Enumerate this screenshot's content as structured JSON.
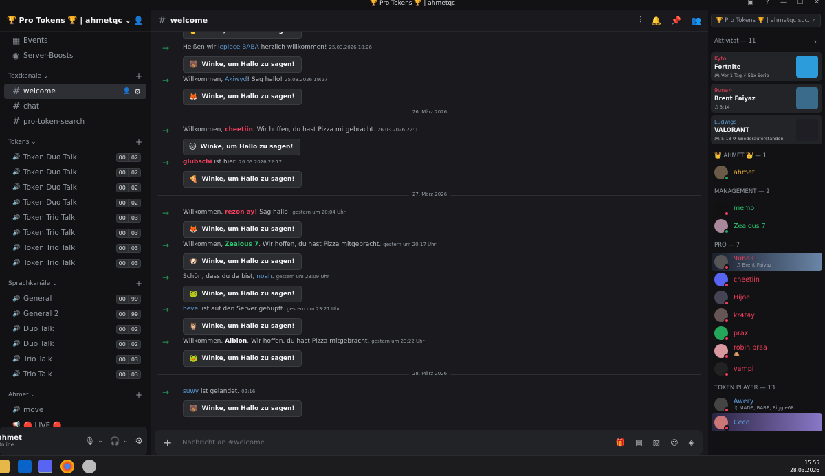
{
  "window": {
    "title": "🏆 Pro Tokens 🏆 | ahmetqc"
  },
  "server": {
    "name": "🏆 Pro Tokens 🏆 | ahmetqc"
  },
  "sidebar": {
    "top_items": [
      {
        "label": "Events",
        "icon": "calendar-icon"
      },
      {
        "label": "Server-Boosts",
        "icon": "boost-icon"
      }
    ],
    "categories": [
      {
        "label": "Textkanäle",
        "channels": [
          {
            "label": "welcome",
            "type": "text",
            "active": true
          },
          {
            "label": "chat",
            "type": "text"
          },
          {
            "label": "pro-token-search",
            "type": "text"
          }
        ]
      },
      {
        "label": "Tokens",
        "channels": [
          {
            "label": "Token Duo Talk",
            "type": "voice",
            "count": "00",
            "limit": "02"
          },
          {
            "label": "Token Duo Talk",
            "type": "voice",
            "count": "00",
            "limit": "02"
          },
          {
            "label": "Token Duo Talk",
            "type": "voice",
            "count": "00",
            "limit": "02"
          },
          {
            "label": "Token Duo Talk",
            "type": "voice",
            "count": "00",
            "limit": "02"
          },
          {
            "label": "Token Trio Talk",
            "type": "voice",
            "count": "00",
            "limit": "03"
          },
          {
            "label": "Token Trio Talk",
            "type": "voice",
            "count": "00",
            "limit": "03"
          },
          {
            "label": "Token Trio Talk",
            "type": "voice",
            "count": "00",
            "limit": "03"
          },
          {
            "label": "Token Trio Talk",
            "type": "voice",
            "count": "00",
            "limit": "03"
          }
        ]
      },
      {
        "label": "Sprachkanäle",
        "channels": [
          {
            "label": "General",
            "type": "voice",
            "count": "00",
            "limit": "99"
          },
          {
            "label": "General 2",
            "type": "voice",
            "count": "00",
            "limit": "99"
          },
          {
            "label": "Duo Talk",
            "type": "voice",
            "count": "00",
            "limit": "02"
          },
          {
            "label": "Duo Talk",
            "type": "voice",
            "count": "00",
            "limit": "02"
          },
          {
            "label": "Trio Talk",
            "type": "voice",
            "count": "00",
            "limit": "03"
          },
          {
            "label": "Trio Talk",
            "type": "voice",
            "count": "00",
            "limit": "03"
          }
        ]
      },
      {
        "label": "Ahmet",
        "channels": [
          {
            "label": "move",
            "type": "voice"
          },
          {
            "label": "🔴 LIVE 🔴",
            "type": "stage"
          }
        ]
      }
    ]
  },
  "user_panel": {
    "name": "ahmet",
    "status": "Online"
  },
  "channel": {
    "name": "welcome",
    "composer_placeholder": "Nachricht an #welcome"
  },
  "search": {
    "placeholder": "🏆 Pro Tokens 🏆 | ahmetqc suc..."
  },
  "wave_label": "Winke, um Hallo zu sagen!",
  "messages": [
    {
      "pre": "Heißen wir ",
      "user": "lepiece BABA",
      "post": " herzlich willkommen!",
      "ts": "25.03.2026 18:26",
      "color": "#5b9bd5"
    },
    {
      "pre": "Willkommen, ",
      "user": "Akiwyd",
      "post": "! Sag hallo!",
      "ts": "25.03.2026 19:27",
      "color": "#5b9bd5"
    },
    {
      "divider": "26. März 2026"
    },
    {
      "pre": "Willkommen, ",
      "user": "cheetiin",
      "post": ". Wir hoffen, du hast Pizza mitgebracht.",
      "ts": "26.03.2026 22:01",
      "color": "#f23f5d"
    },
    {
      "pre": "",
      "user": "glubschi",
      "post": " ist hier.",
      "ts": "26.03.2026 22:17",
      "color": "#f23f5d"
    },
    {
      "divider": "27. März 2026"
    },
    {
      "pre": "Willkommen, ",
      "user": "rezon ay!",
      "post": " Sag hallo!",
      "ts": "gestern um 20:04 Uhr",
      "color": "#f23f5d"
    },
    {
      "pre": "Willkommen, ",
      "user": "Zealous 7",
      "post": ". Wir hoffen, du hast Pizza mitgebracht.",
      "ts": "gestern um 20:17 Uhr",
      "color": "#2dc770"
    },
    {
      "pre": "Schön, dass du da bist, ",
      "user": "noah",
      "post": ".",
      "ts": "gestern um 23:09 Uhr",
      "color": "#5b9bd5"
    },
    {
      "pre": "",
      "user": "bevel",
      "post": " ist auf den Server gehüpft.",
      "ts": "gestern um 23:21 Uhr",
      "color": "#5b9bd5"
    },
    {
      "pre": "Willkommen, ",
      "user": "Albion",
      "post": ". Wir hoffen, du hast Pizza mitgebracht.",
      "ts": "gestern um 23:22 Uhr",
      "color": "#f2f3f5"
    },
    {
      "divider": "28. März 2026"
    },
    {
      "pre": "",
      "user": "suwy",
      "post": " ist gelandet.",
      "ts": "02:16",
      "color": "#5b9bd5"
    }
  ],
  "activity": {
    "header": "Aktivität — 11",
    "cards": [
      {
        "user": "Kyto",
        "title": "Fortnite",
        "detail": "🎮 Vor 1 Tag  ⚡ 51x Serie",
        "user_color": "#f23f5d",
        "thumb_color": "#2d9cdb"
      },
      {
        "user": "9una✧",
        "title": "Brent Faiyaz",
        "detail": "♫ 3:14",
        "user_color": "#f23f5d",
        "thumb_color": "#3a6b8a"
      },
      {
        "user": "Ludwigs",
        "title": "VALORANT",
        "detail": "🎮 5:18  ⟳ Wiederauferstanden",
        "user_color": "#5b9bd5",
        "thumb_color": "#1e1e24"
      }
    ]
  },
  "member_groups": [
    {
      "label": "👑 AHMET 👑 — 1",
      "members": [
        {
          "name": "ahmet",
          "color": "#f0b232",
          "status": "#23a55a",
          "av": "#6b5a48"
        }
      ]
    },
    {
      "label": "MANAGEMENT — 2",
      "members": [
        {
          "name": "memo",
          "color": "#2dc770",
          "status": "#f23f5d",
          "av": "#111"
        },
        {
          "name": "Zealous 7",
          "color": "#2dc770",
          "status": "#23a55a",
          "av": "#a8889a"
        }
      ]
    },
    {
      "label": "PRO — 7",
      "members": [
        {
          "name": "9una✧",
          "color": "#f23f5d",
          "status": "#f23f5d",
          "av": "#555",
          "sub": "♫ Brent Faiyaz"
        },
        {
          "name": "cheetiin",
          "color": "#f23f5d",
          "status": "#f23f5d",
          "av": "#5865f2"
        },
        {
          "name": "Hijoe",
          "color": "#f23f5d",
          "status": "#f23f5d",
          "av": "#445"
        },
        {
          "name": "kr4t4y",
          "color": "#f23f5d",
          "status": "#f23f5d",
          "av": "#655"
        },
        {
          "name": "prax",
          "color": "#f23f5d",
          "status": "#f23f5d",
          "av": "#23a55a"
        },
        {
          "name": "robin braa",
          "color": "#f23f5d",
          "status": "#f23f5d",
          "av": "#d89aa0",
          "sub": "🙈"
        },
        {
          "name": "vampi",
          "color": "#f23f5d",
          "status": "#f23f5d",
          "av": "#222"
        }
      ]
    },
    {
      "label": "TOKEN PLAYER — 13",
      "members": [
        {
          "name": "Awery",
          "color": "#5b9bd5",
          "status": "#f23f5d",
          "av": "#444",
          "sub": "♫ MADE, BARÉ, Biggie68"
        },
        {
          "name": "Ceco",
          "color": "#5b9bd5",
          "status": "#f23f5d",
          "av": "#c77",
          "banner": true
        }
      ]
    }
  ],
  "clock": {
    "time": "15:55",
    "date": "28.03.2026"
  }
}
